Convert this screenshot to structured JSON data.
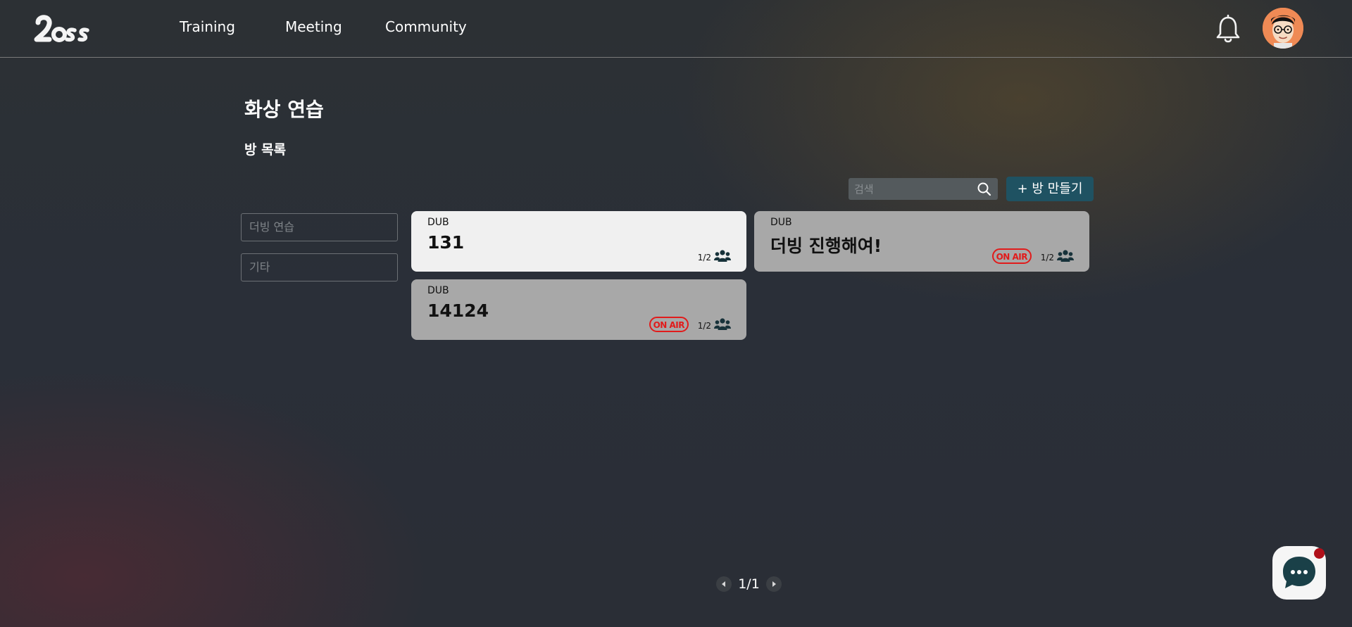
{
  "header": {
    "logo_text": "Voss",
    "nav": [
      {
        "label": "Training"
      },
      {
        "label": "Meeting"
      },
      {
        "label": "Community"
      }
    ]
  },
  "page": {
    "title": "화상 연습",
    "section_title": "방 목록"
  },
  "search": {
    "placeholder": "검색",
    "value": ""
  },
  "create_button": {
    "label": "+ 방 만들기"
  },
  "filters": [
    {
      "label": "더빙 연습"
    },
    {
      "label": "기타"
    }
  ],
  "rooms": [
    {
      "category": "DUB",
      "name": "131",
      "count": "1/2",
      "on_air": false
    },
    {
      "category": "DUB",
      "name": "더빙 진행해여!",
      "count": "1/2",
      "on_air": true,
      "on_air_label": "ON AIR"
    },
    {
      "category": "DUB",
      "name": "14124",
      "count": "1/2",
      "on_air": true,
      "on_air_label": "ON AIR"
    }
  ],
  "pagination": {
    "label": "1/1"
  },
  "colors": {
    "accent": "#1f5262",
    "on_air": "#e11b1b",
    "card_active": "#f0f0f0",
    "card": "#a8a8a8"
  },
  "icons": [
    "bell-icon",
    "avatar",
    "search-icon",
    "people-icon",
    "chevron-left-icon",
    "chevron-right-icon",
    "chat-icon"
  ]
}
